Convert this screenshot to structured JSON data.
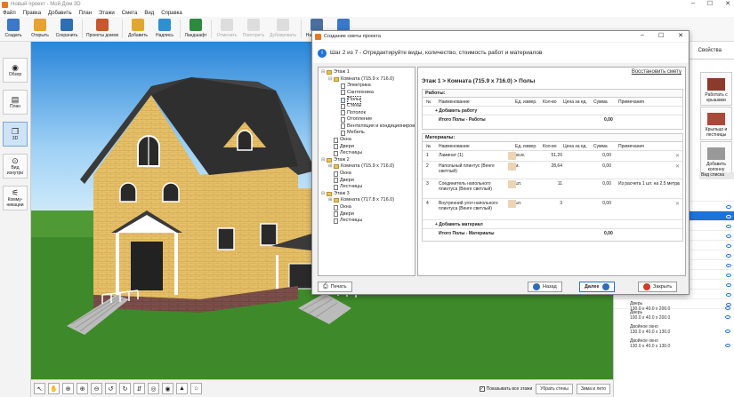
{
  "window": {
    "title": "Новый проект - Мой Дом 3D"
  },
  "menu": [
    "Файл",
    "Правка",
    "Добавить",
    "План",
    "Этажи",
    "Смета",
    "Вид",
    "Справка"
  ],
  "toolbar": [
    {
      "label": "Создать",
      "icon": "new-doc-icon",
      "disabled": false,
      "color": "#3b78c7"
    },
    {
      "label": "Открыть",
      "icon": "folder-open-icon",
      "disabled": false,
      "color": "#e7a32b"
    },
    {
      "label": "Сохранить",
      "icon": "save-icon",
      "disabled": false,
      "color": "#2f6db5"
    },
    {
      "label": "Проекты домов",
      "icon": "house-projects-icon",
      "disabled": false,
      "color": "#c9572b"
    },
    {
      "label": "Добавить",
      "icon": "add-icon",
      "disabled": false,
      "color": "#e0a82e"
    },
    {
      "label": "Надпись",
      "icon": "label-icon",
      "disabled": false,
      "color": "#2f8fd0"
    },
    {
      "label": "Ландшафт",
      "icon": "landscape-icon",
      "disabled": false,
      "color": "#2d8a3e"
    },
    {
      "label": "Отменить",
      "icon": "undo-icon",
      "disabled": true,
      "color": "#cccccc"
    },
    {
      "label": "Повторить",
      "icon": "redo-icon",
      "disabled": true,
      "color": "#cccccc"
    },
    {
      "label": "Дублировать",
      "icon": "duplicate-icon",
      "disabled": true,
      "color": "#cccccc"
    },
    {
      "label": "Настройки",
      "icon": "settings-icon",
      "disabled": false,
      "color": "#4a6fa0"
    },
    {
      "label": "Справка",
      "icon": "help-icon",
      "disabled": false,
      "color": "#3b78c7"
    }
  ],
  "leftpanel": [
    {
      "label": "Обзор",
      "icon": "eye-icon",
      "active": false
    },
    {
      "label": "План",
      "icon": "plan-icon",
      "active": false
    },
    {
      "label": "3D",
      "icon": "cube-3d-icon",
      "active": true
    },
    {
      "label": "Вид изнутри",
      "icon": "inside-view-icon",
      "active": false
    },
    {
      "label": "Комму-никации",
      "icon": "communications-icon",
      "active": false
    }
  ],
  "bottombar": {
    "show_all_floors": "Показывать все этажи",
    "hide_walls": "Убрать стены",
    "winter_summer": "Зима и лето"
  },
  "rightpanel": {
    "tab_props": "Свойства",
    "obj1": "Работать с крышами",
    "obj2": "Крыльцо и лестницы",
    "obj3": "Добавить колонну",
    "header": "Вид списка",
    "items": [
      {
        "name": "Дверь",
        "dims": "130.0 x 40.0 x 200.0"
      },
      {
        "name": "Дверь",
        "dims": "100.0 x 40.0 x 200.0"
      },
      {
        "name": "Двойное окно",
        "dims": "130.0 x 40.0 x 130.0"
      },
      {
        "name": "Двойное окно",
        "dims": "130.0 x 40.0 x 130.0"
      }
    ]
  },
  "dialog": {
    "title": "Создание сметы проекта",
    "step_text": "Шаг 2 из 7 - Отредактируйте виды, количество, стоимость работ и материалов",
    "restore": "Восстановить смету",
    "breadcrumb": "Этаж 1 > Комната (715.9 x 716.0) > Полы",
    "tree": [
      {
        "text": "Этаж 1",
        "lvl": 0,
        "type": "folder",
        "exp": "⊟"
      },
      {
        "text": "Комната (715.9 x 716.0)",
        "lvl": 1,
        "type": "folder",
        "exp": "⊟"
      },
      {
        "text": "Электрика",
        "lvl": 2,
        "type": "file"
      },
      {
        "text": "Сантехника",
        "lvl": 2,
        "type": "file"
      },
      {
        "text": "Полы",
        "lvl": 2,
        "type": "file",
        "sel": true
      },
      {
        "text": "Стены",
        "lvl": 2,
        "type": "file"
      },
      {
        "text": "Потолок",
        "lvl": 2,
        "type": "file"
      },
      {
        "text": "Отопление",
        "lvl": 2,
        "type": "file"
      },
      {
        "text": "Вентиляция и кондиционирование",
        "lvl": 2,
        "type": "file"
      },
      {
        "text": "Мебель",
        "lvl": 2,
        "type": "file"
      },
      {
        "text": "Окна",
        "lvl": 1,
        "type": "file"
      },
      {
        "text": "Двери",
        "lvl": 1,
        "type": "file"
      },
      {
        "text": "Лестницы",
        "lvl": 1,
        "type": "file"
      },
      {
        "text": "Этаж 2",
        "lvl": 0,
        "type": "folder",
        "exp": "⊟"
      },
      {
        "text": "Комната (715.9 x 716.0)",
        "lvl": 1,
        "type": "folder",
        "exp": "⊞"
      },
      {
        "text": "Окна",
        "lvl": 1,
        "type": "file"
      },
      {
        "text": "Двери",
        "lvl": 1,
        "type": "file"
      },
      {
        "text": "Лестницы",
        "lvl": 1,
        "type": "file"
      },
      {
        "text": "Этаж 3",
        "lvl": 0,
        "type": "folder",
        "exp": "⊟"
      },
      {
        "text": "Комната (717.8 x 716.0)",
        "lvl": 1,
        "type": "folder",
        "exp": "⊞"
      },
      {
        "text": "Окна",
        "lvl": 1,
        "type": "file"
      },
      {
        "text": "Двери",
        "lvl": 1,
        "type": "file"
      },
      {
        "text": "Лестницы",
        "lvl": 1,
        "type": "file"
      }
    ],
    "works": {
      "title": "Работы:",
      "cols": [
        "№",
        "Наименование",
        "Ед. измер.",
        "Кол-во",
        "Цена за ед.",
        "Сумма",
        "Примечания"
      ],
      "add": "+ Добавить работу",
      "total_label": "Итого Полы - Работы",
      "total": "0,00"
    },
    "materials": {
      "title": "Материалы:",
      "cols": [
        "№",
        "Наименование",
        "Ед. измер.",
        "Кол-во",
        "Цена за ед.",
        "Сумма",
        "Примечания"
      ],
      "rows": [
        {
          "n": "1",
          "name": "Ламинат (1)",
          "unit": "кв.м.",
          "qty": "51,26",
          "price": "",
          "sum": "0,00",
          "note": ""
        },
        {
          "n": "2",
          "name": "Напольный плинтус (Венге светлый)",
          "unit": "м.",
          "qty": "28,64",
          "price": "",
          "sum": "0,00",
          "note": ""
        },
        {
          "n": "3",
          "name": "Соединитель напольного плинтуса (Венге светлый)",
          "unit": "шт.",
          "qty": "11",
          "price": "",
          "sum": "0,00",
          "note": "Из расчета 1 шт. на 2,5 метра"
        },
        {
          "n": "4",
          "name": "Внутренний угол напольного плинтуса (Венге светлый)",
          "unit": "шт.",
          "qty": "3",
          "price": "",
          "sum": "0,00",
          "note": ""
        }
      ],
      "add": "+ Добавить материал",
      "total_label": "Итого Полы - Материалы",
      "total": "0,00"
    },
    "buttons": {
      "print": "Печать",
      "back": "Назад",
      "next": "Далее",
      "close": "Закрыть"
    }
  }
}
